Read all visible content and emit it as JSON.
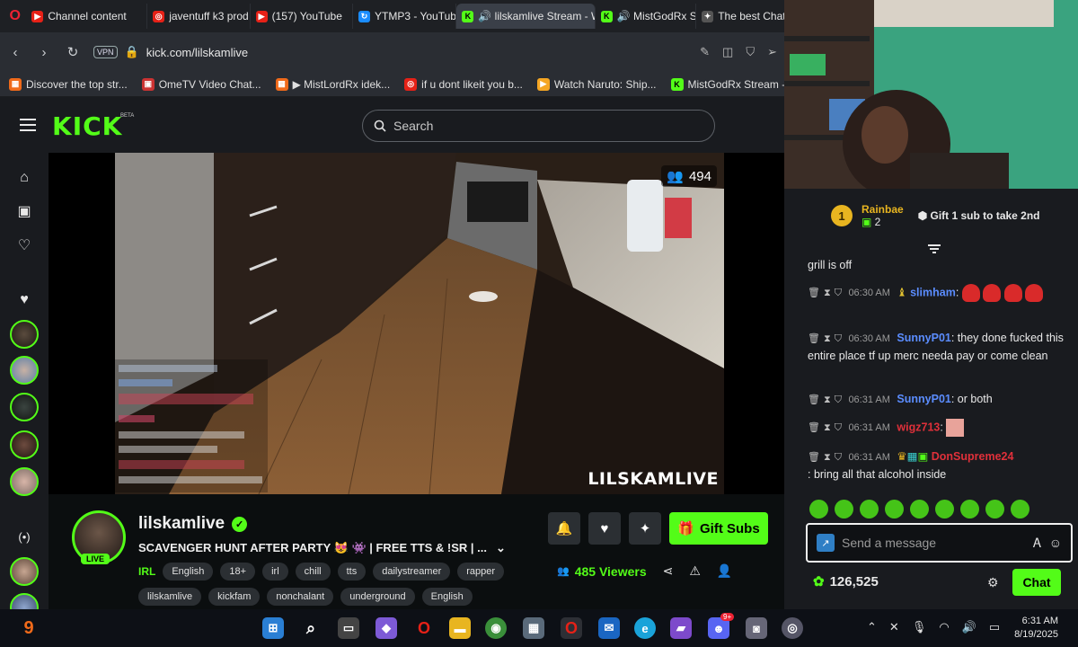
{
  "browser": {
    "tabs": [
      {
        "label": "Channel content",
        "color": "#e62117",
        "glyph": "▶"
      },
      {
        "label": "javentuff k3 prod",
        "color": "#e62117",
        "glyph": "◎"
      },
      {
        "label": "(157) YouTube",
        "color": "#e62117",
        "glyph": "▶"
      },
      {
        "label": "YTMP3 - YouTube",
        "color": "#1a8cff",
        "glyph": "↻"
      },
      {
        "label": "🔊 lilskamlive Stream - W",
        "color": "#53fc18",
        "glyph": "K"
      },
      {
        "label": "🔊 MistGodRx St",
        "color": "#53fc18",
        "glyph": "K"
      },
      {
        "label": "The best ChatB",
        "color": "#cccccc",
        "glyph": "✦"
      }
    ],
    "vpn_label": "VPN",
    "url": "kick.com/lilskamlive",
    "bookmarks": [
      {
        "label": "Discover the top str...",
        "color": "#f06a1a",
        "glyph": "▦"
      },
      {
        "label": "OmeTV Video Chat...",
        "color": "#c33",
        "glyph": "▣"
      },
      {
        "label": "▶ MistLordRx idek...",
        "color": "#f06a1a",
        "glyph": "▦"
      },
      {
        "label": "if u dont likeit you b...",
        "color": "#e62117",
        "glyph": "◎"
      },
      {
        "label": "Watch Naruto: Ship...",
        "color": "#f5a623",
        "glyph": "▶"
      },
      {
        "label": "MistGodRx Stream -...",
        "color": "#53fc18",
        "glyph": "K"
      }
    ]
  },
  "kick": {
    "logo": "KICK",
    "beta": "BETA",
    "search_placeholder": "Search"
  },
  "video": {
    "viewer_count": "494",
    "watermark": "LILSKAMLIVE"
  },
  "stream": {
    "streamer": "lilskamlive",
    "live_label": "LIVE",
    "title": "SCAVENGER HUNT AFTER PARTY 😻 👾 | FREE TTS & !SR | ...",
    "category": "IRL",
    "tags_row1": [
      "English",
      "18+",
      "irl",
      "chill",
      "tts",
      "dailystreamer",
      "rapper"
    ],
    "tags_row2": [
      "lilskamlive",
      "kickfam",
      "nonchalant",
      "underground",
      "English"
    ],
    "gift_label": "Gift Subs",
    "viewers": "485 Viewers"
  },
  "chat": {
    "leader": {
      "rank": "1",
      "name": "Rainbae",
      "count": "2"
    },
    "gift_prompt": "Gift 1 sub to take 2nd",
    "messages": [
      {
        "time": "",
        "user": "",
        "user_color": "#e8e8e8",
        "text": "grill is off"
      },
      {
        "time": "06:30 AM",
        "user": "slimham",
        "user_color": "#5b8dff",
        "text": ":"
      },
      {
        "time": "06:30 AM",
        "user": "SunnyP01",
        "user_color": "#5b8dff",
        "text": ": they done fucked this entire place tf up merc needa pay or come clean"
      },
      {
        "time": "06:31 AM",
        "user": "SunnyP01",
        "user_color": "#5b8dff",
        "text": ": or both"
      },
      {
        "time": "06:31 AM",
        "user": "wigz713",
        "user_color": "#e0303a",
        "text": ":"
      },
      {
        "time": "06:31 AM",
        "user": "DonSupreme24",
        "user_color": "#e0303a",
        "text": ": bring all that alcohol inside"
      }
    ],
    "input_placeholder": "Send a message",
    "points": "126,525",
    "chat_button": "Chat"
  },
  "taskbar": {
    "time": "6:31 AM",
    "date": "8/19/2025",
    "badge": "9+"
  }
}
